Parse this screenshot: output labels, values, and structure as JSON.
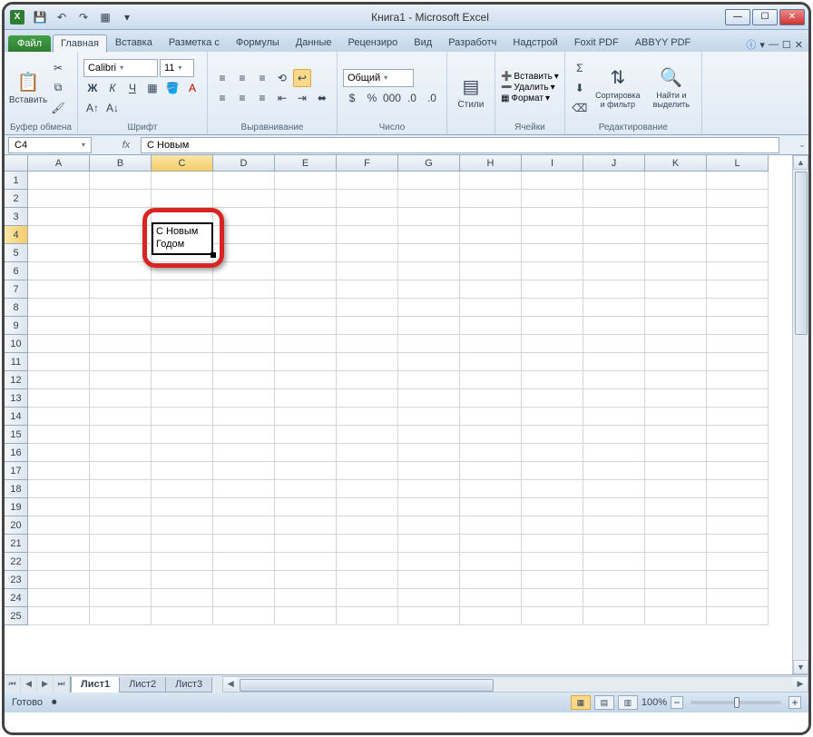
{
  "window": {
    "title": "Книга1  -  Microsoft Excel"
  },
  "qat": {
    "save": "save",
    "undo": "undo",
    "redo": "redo",
    "new": "new"
  },
  "tabs": {
    "file": "Файл",
    "items": [
      "Главная",
      "Вставка",
      "Разметка с",
      "Формулы",
      "Данные",
      "Рецензиро",
      "Вид",
      "Разработч",
      "Надстрой",
      "Foxit PDF",
      "ABBYY PDF"
    ],
    "active": 0
  },
  "ribbon": {
    "clipboard": {
      "paste": "Вставить",
      "label": "Буфер обмена"
    },
    "font": {
      "name": "Calibri",
      "size": "11",
      "label": "Шрифт"
    },
    "align": {
      "label": "Выравнивание"
    },
    "number": {
      "format": "Общий",
      "label": "Число"
    },
    "styles": {
      "btn": "Стили",
      "label": ""
    },
    "cells": {
      "insert": "Вставить",
      "delete": "Удалить",
      "format": "Формат",
      "label": "Ячейки"
    },
    "editing": {
      "sort": "Сортировка\nи фильтр",
      "find": "Найти и\nвыделить",
      "label": "Редактирование"
    }
  },
  "fbar": {
    "namebox": "C4",
    "formula": "С Новым"
  },
  "grid": {
    "cols": [
      "A",
      "B",
      "C",
      "D",
      "E",
      "F",
      "G",
      "H",
      "I",
      "J",
      "K",
      "L"
    ],
    "rows": 25,
    "activeCol": "C",
    "activeRow": 4,
    "cellText": "С Новым\nГодом"
  },
  "sheets": {
    "tabs": [
      "Лист1",
      "Лист2",
      "Лист3"
    ],
    "active": 0
  },
  "status": {
    "ready": "Готово",
    "zoom": "100%"
  }
}
